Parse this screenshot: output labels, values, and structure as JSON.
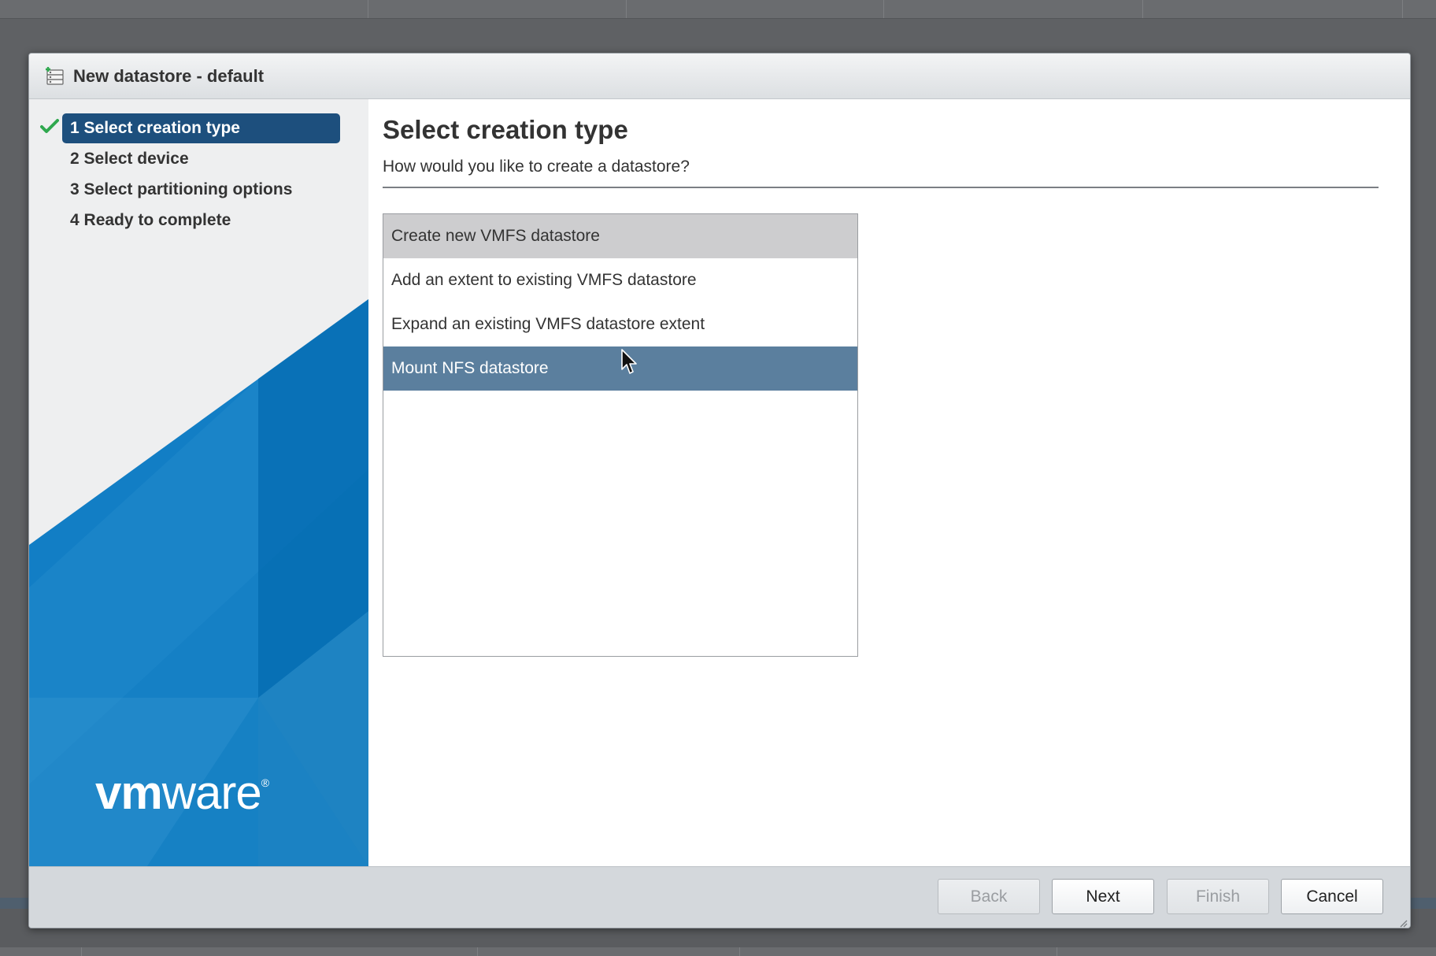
{
  "dialog": {
    "title": "New datastore - default"
  },
  "wizard": {
    "steps": [
      {
        "number": "1",
        "label": "Select creation type",
        "active": true,
        "completed": true
      },
      {
        "number": "2",
        "label": "Select device"
      },
      {
        "number": "3",
        "label": "Select partitioning options"
      },
      {
        "number": "4",
        "label": "Ready to complete"
      }
    ]
  },
  "brand": {
    "logo_vm": "vm",
    "logo_ware": "ware",
    "logo_reg": "®"
  },
  "page": {
    "title": "Select creation type",
    "subtitle": "How would you like to create a datastore?"
  },
  "options": [
    {
      "label": "Create new VMFS datastore",
      "state": "hover"
    },
    {
      "label": "Add an extent to existing VMFS datastore",
      "state": "normal"
    },
    {
      "label": "Expand an existing VMFS datastore extent",
      "state": "normal"
    },
    {
      "label": "Mount NFS datastore",
      "state": "selected"
    }
  ],
  "footer": {
    "back_label": "Back",
    "next_label": "Next",
    "finish_label": "Finish",
    "cancel_label": "Cancel"
  },
  "colors": {
    "active_step": "#1d4f7d",
    "selected_option": "#5b7f9e",
    "hover_option": "#cdcdcf",
    "check": "#2fa84f",
    "brand_blue": "#0a78c0"
  },
  "icons": {
    "title": "datastore-icon",
    "step_done": "check-icon",
    "pointer": "mouse-cursor-icon"
  }
}
